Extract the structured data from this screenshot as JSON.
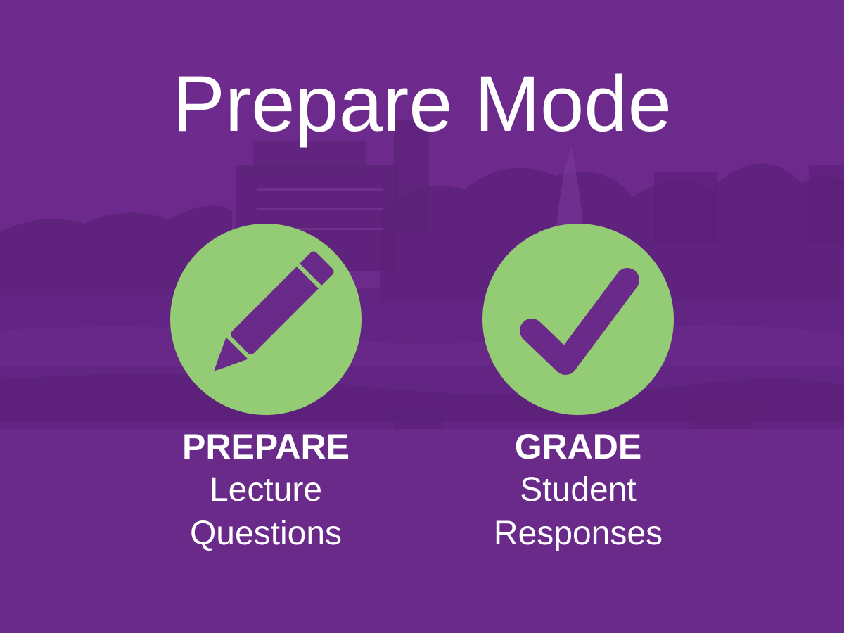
{
  "slide": {
    "title": "Prepare Mode",
    "background_color": "#6a2a8a",
    "accent_color": "#93cc74"
  },
  "modes": [
    {
      "icon": "pencil-icon",
      "heading": "PREPARE",
      "line1": "Lecture",
      "line2": "Questions"
    },
    {
      "icon": "checkmark-icon",
      "heading": "GRADE",
      "line1": "Student",
      "line2": "Responses"
    }
  ]
}
